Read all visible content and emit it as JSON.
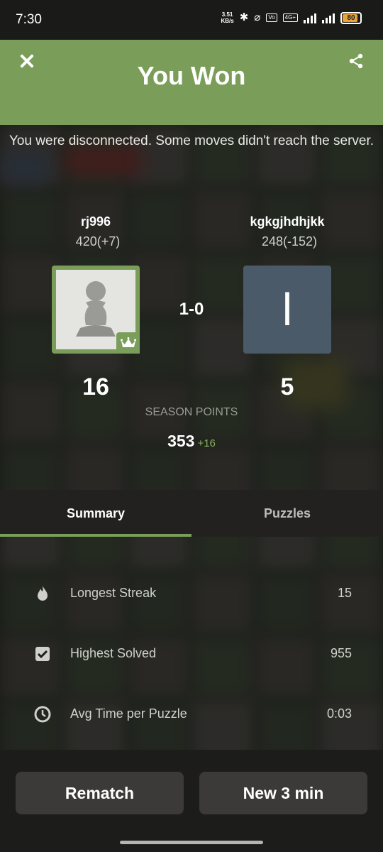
{
  "status_bar": {
    "time": "7:30",
    "net_speed_value": "3.51",
    "net_speed_unit": "KB/s",
    "network": "4G+",
    "battery": "80",
    "battery_level": 0.8
  },
  "header": {
    "title": "You Won",
    "color": "#7a9e59"
  },
  "notice": "You were disconnected. Some moves didn't reach the server.",
  "players": [
    {
      "name": "rj996",
      "rating": "420(+7)",
      "points": "16",
      "avatar": "pawn-icon",
      "winner_badge": "crown-icon"
    },
    {
      "name": "kgkgjhdhjkk",
      "rating": "248(-152)",
      "points": "5",
      "avatar_letter": "l"
    }
  ],
  "score": "1-0",
  "season": {
    "label": "SEASON POINTS",
    "value": "353",
    "delta": "+16"
  },
  "tabs": {
    "summary": "Summary",
    "puzzles": "Puzzles",
    "active": "summary"
  },
  "stats": [
    {
      "icon": "flame-icon",
      "label": "Longest Streak",
      "value": "15"
    },
    {
      "icon": "checkbox-icon",
      "label": "Highest Solved",
      "value": "955"
    },
    {
      "icon": "clock-icon",
      "label": "Avg Time per Puzzle",
      "value": "0:03"
    }
  ],
  "buttons": {
    "rematch": "Rematch",
    "new_game": "New 3 min"
  }
}
